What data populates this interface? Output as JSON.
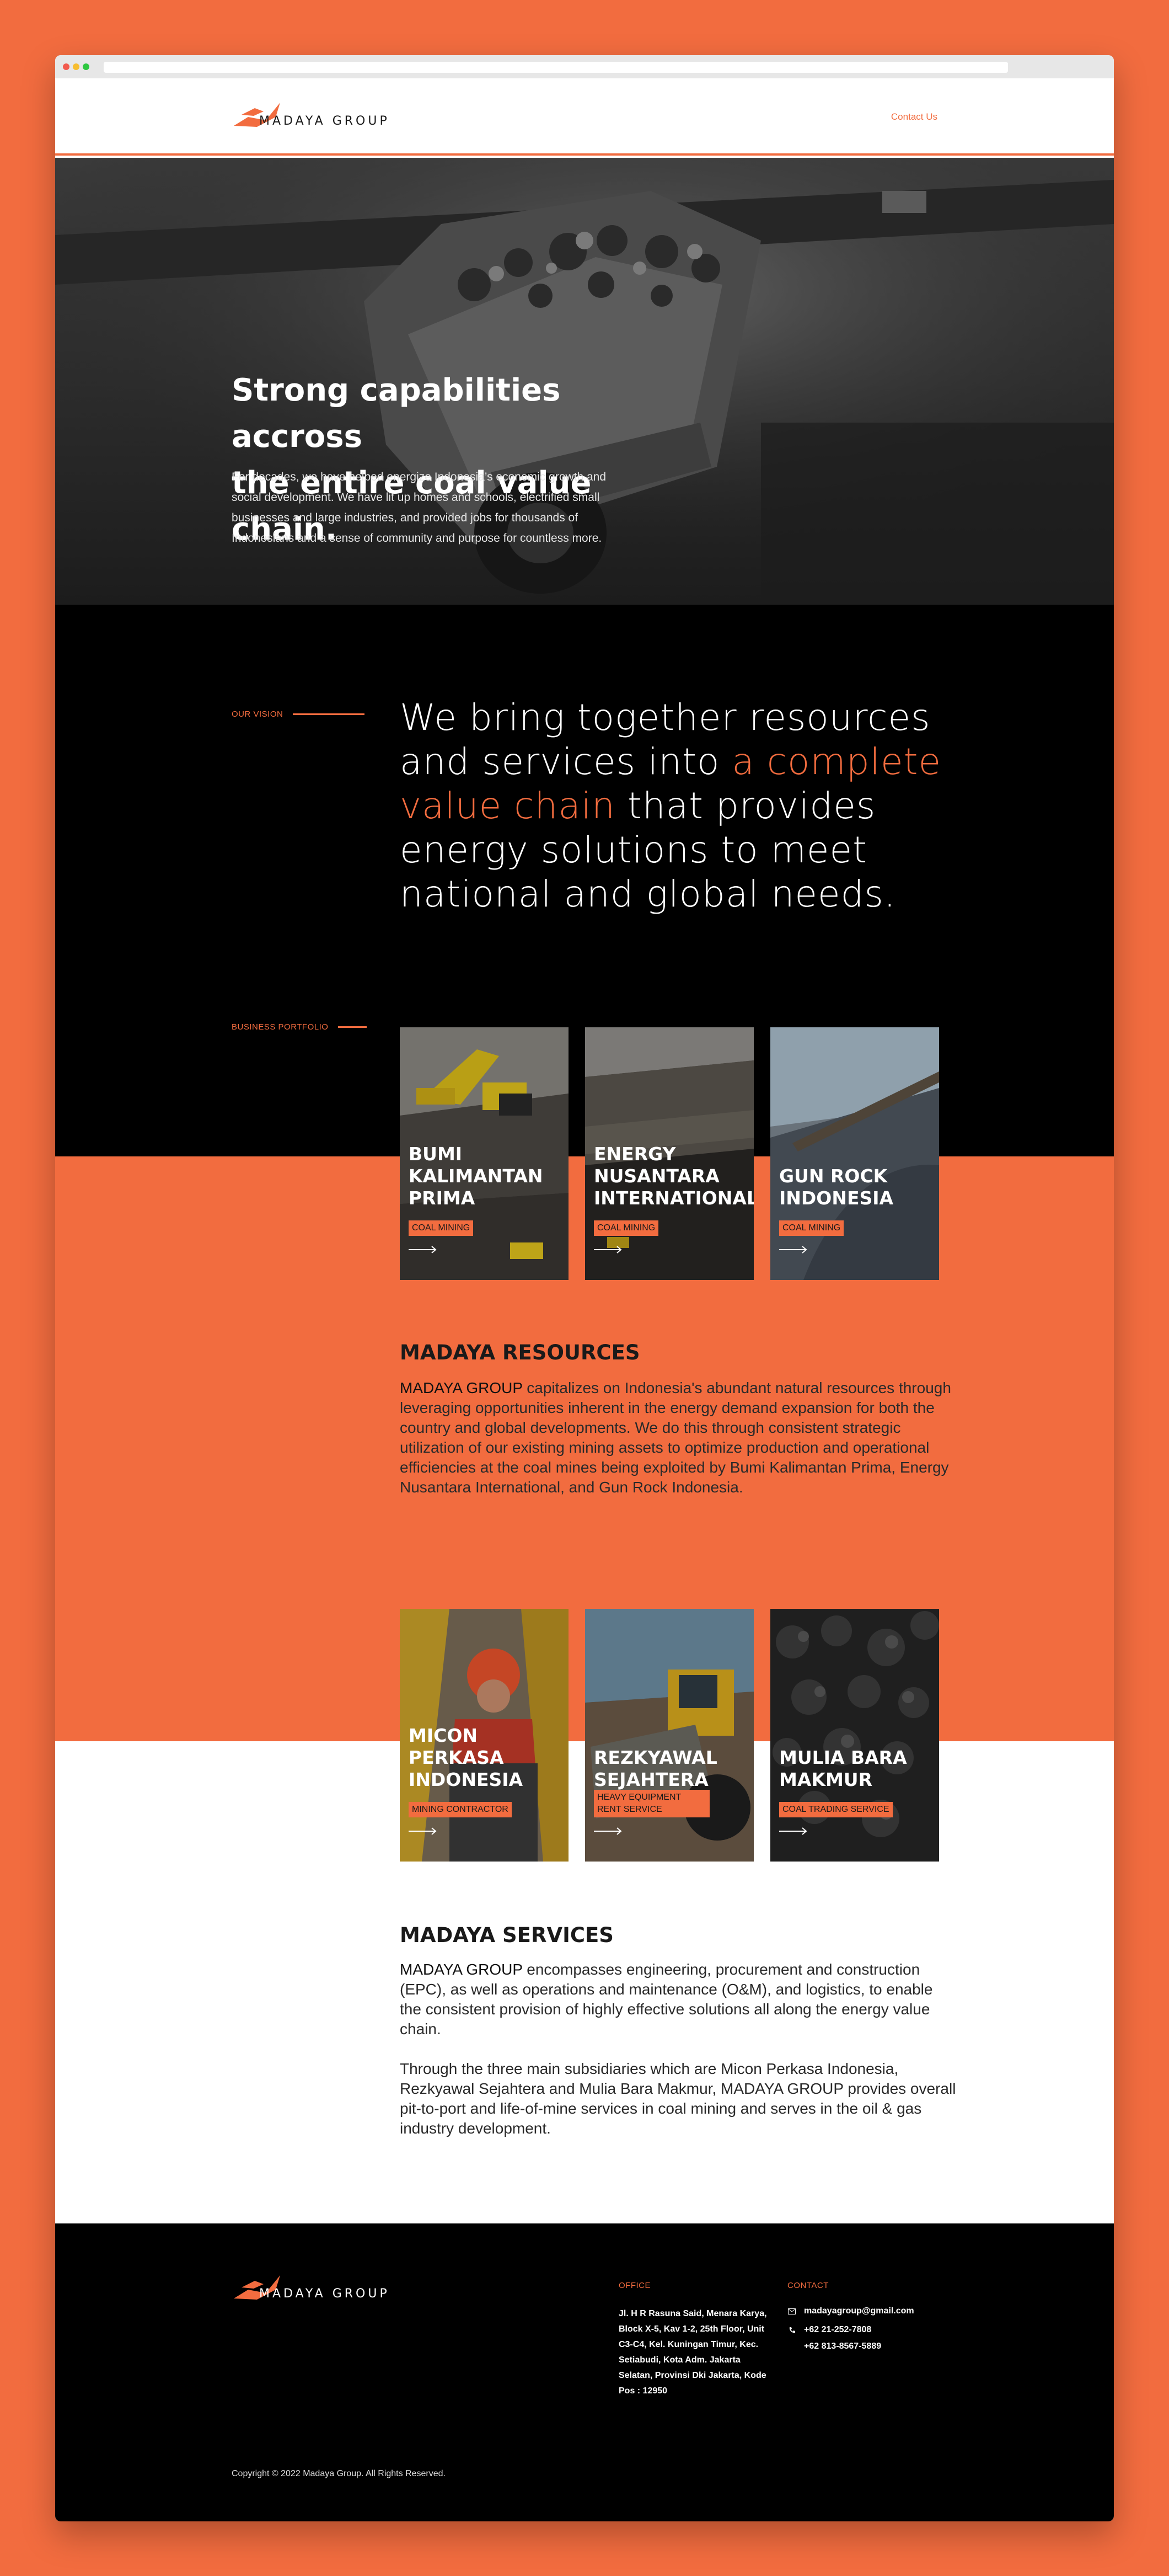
{
  "colors": {
    "accent": "#f26c3f",
    "dark": "#000000",
    "light": "#ffffff"
  },
  "header": {
    "logo_text": "MADAYA GROUP",
    "contact_label": "Contact Us"
  },
  "hero": {
    "title_line1": "Strong capabilities accross",
    "title_line2": "the entire coal value chain.",
    "text": "For decades, we have helped energize Indonesia’s economic growth and social development. We have lit up homes and schools, electrified small businesses and large industries, and provided jobs for thousands of Indonesians and a sense of community and purpose for countless more."
  },
  "vision": {
    "label": "OUR VISION",
    "statement_part1": "We bring together resources and services into ",
    "statement_highlight": "a complete value chain",
    "statement_part2": " that provides energy solutions to meet national and global needs."
  },
  "portfolio": {
    "label": "BUSINESS PORTFOLIO",
    "resources_cards": [
      {
        "title": "BUMI KALIMANTAN PRIMA",
        "tag": "COAL MINING",
        "arrow_icon": "arrow-right-icon"
      },
      {
        "title": "ENERGY NUSANTARA INTERNATIONAL",
        "tag": "COAL MINING",
        "arrow_icon": "arrow-right-icon"
      },
      {
        "title": "GUN ROCK INDONESIA",
        "tag": "COAL MINING",
        "arrow_icon": "arrow-right-icon"
      }
    ],
    "services_cards": [
      {
        "title": "MICON PERKASA INDONESIA",
        "tag": "MINING CONTRACTOR",
        "arrow_icon": "arrow-right-icon"
      },
      {
        "title": "REZKYAWAL SEJAHTERA",
        "tag": "HEAVY EQUIPMENT RENT SERVICE",
        "arrow_icon": "arrow-right-icon"
      },
      {
        "title": "MULIA BARA MAKMUR",
        "tag": "COAL TRADING SERVICE",
        "arrow_icon": "arrow-right-icon"
      }
    ]
  },
  "resources": {
    "heading": "MADAYA RESOURCES",
    "brand": "MADAYA GROUP",
    "text": " capitalizes on Indonesia's abundant natural resources through leveraging opportunities inherent in the energy demand expansion for both the country and global developments. We do this through consistent strategic utilization of our existing mining assets to optimize production and operational efficiencies at the coal mines being exploited by Bumi Kalimantan Prima, Energy Nusantara International, and Gun Rock Indonesia."
  },
  "services": {
    "heading": "MADAYA SERVICES",
    "brand": "MADAYA GROUP",
    "text1": " encompasses engineering, procurement and construction (EPC), as well as operations and maintenance (O&M), and logistics, to enable the consistent provision of highly effective solutions all along the energy value chain.",
    "text2": "Through the three main subsidiaries which are Micon Perkasa Indonesia, Rezkyawal Sejahtera and Mulia Bara Makmur, MADAYA GROUP provides overall pit-to-port and life-of-mine services in coal mining and serves in the oil & gas industry development."
  },
  "footer": {
    "logo_text": "MADAYA GROUP",
    "office_label": "OFFICE",
    "office_address": "Jl. H R Rasuna Said, Menara Karya, Block X-5, Kav 1-2, 25th Floor, Unit C3-C4, Kel. Kuningan Timur, Kec. Setiabudi, Kota Adm. Jakarta Selatan, Provinsi Dki Jakarta, Kode Pos : 12950",
    "contact_label": "CONTACT",
    "email": "madayagroup@gmail.com",
    "phone1": "+62 21-252-7808",
    "phone2": "+62 813-8567-5889",
    "copyright": "Copyright © 2022 Madaya Group. All Rights Reserved."
  }
}
